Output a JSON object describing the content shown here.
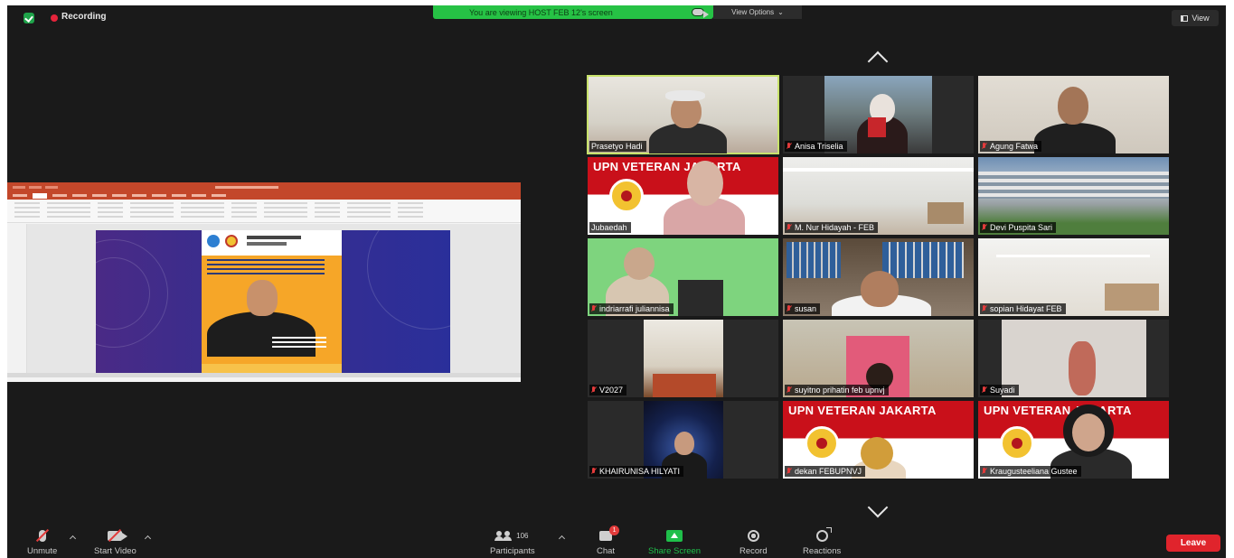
{
  "top_bar": {
    "recording_label": "Recording",
    "viewing_banner": "You are viewing HOST FEB 12's screen",
    "view_options_label": "View Options",
    "view_label": "View"
  },
  "participants": [
    {
      "name": "Prasetyo Hadi",
      "muted": false,
      "active_speaker": true
    },
    {
      "name": "Anisa Triselia",
      "muted": true
    },
    {
      "name": "Agung Fatwa",
      "muted": true
    },
    {
      "name": "Jubaedah",
      "muted": false
    },
    {
      "name": "M. Nur Hidayah - FEB",
      "muted": true
    },
    {
      "name": "Devi Puspita Sari",
      "muted": true
    },
    {
      "name": "indriarrafi juliannisa",
      "muted": true
    },
    {
      "name": "susan",
      "muted": true
    },
    {
      "name": "sopian Hidayat FEB",
      "muted": true
    },
    {
      "name": "V2027",
      "muted": true
    },
    {
      "name": "suyitno prihatin feb upnvj",
      "muted": true
    },
    {
      "name": "Suyadi",
      "muted": true
    },
    {
      "name": "KHAIRUNISA HILYATI",
      "muted": true
    },
    {
      "name": "dekan FEBUPNVJ",
      "muted": true
    },
    {
      "name": "Kraugusteeliana Gustee",
      "muted": true
    }
  ],
  "video_overlays": {
    "upn_banner": "UPN VETERAN JAKARTA"
  },
  "toolbar": {
    "unmute_label": "Unmute",
    "start_video_label": "Start Video",
    "participants_label": "Participants",
    "participants_count": "106",
    "chat_label": "Chat",
    "chat_badge": "1",
    "share_screen_label": "Share Screen",
    "record_label": "Record",
    "reactions_label": "Reactions",
    "leave_label": "Leave"
  },
  "colors": {
    "background": "#1a1a1a",
    "viewing_banner": "#26c245",
    "share_green": "#1fbf4a",
    "leave_red": "#e0242c",
    "active_speaker_border": "#c8e26b",
    "upn_red": "#c9101a"
  }
}
